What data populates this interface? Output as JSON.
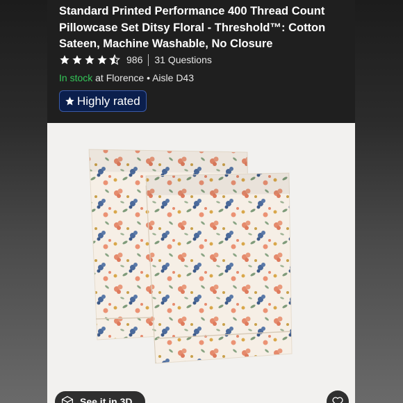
{
  "product": {
    "title": "Standard Printed Performance 400 Thread Count Pillowcase Set Ditsy Floral - Threshold™: Cotton Sateen, Machine Washable, No Closure",
    "rating": {
      "value": 4.5,
      "max": 5,
      "review_count": "986",
      "questions": "31 Questions"
    },
    "stock": {
      "status": "In stock",
      "location": "at Florence • Aisle D43"
    },
    "badge": "Highly rated",
    "image_alt": "Ditsy floral pillowcase set",
    "see_in_3d": "See it in 3D",
    "icons": [
      "star-icon",
      "3d-cube-icon",
      "heart-icon"
    ]
  },
  "colors": {
    "background": "#1f1f1f",
    "in_stock": "#34c759",
    "badge_bg": "#0b1f4d",
    "image_bg": "#f2f1ef"
  }
}
